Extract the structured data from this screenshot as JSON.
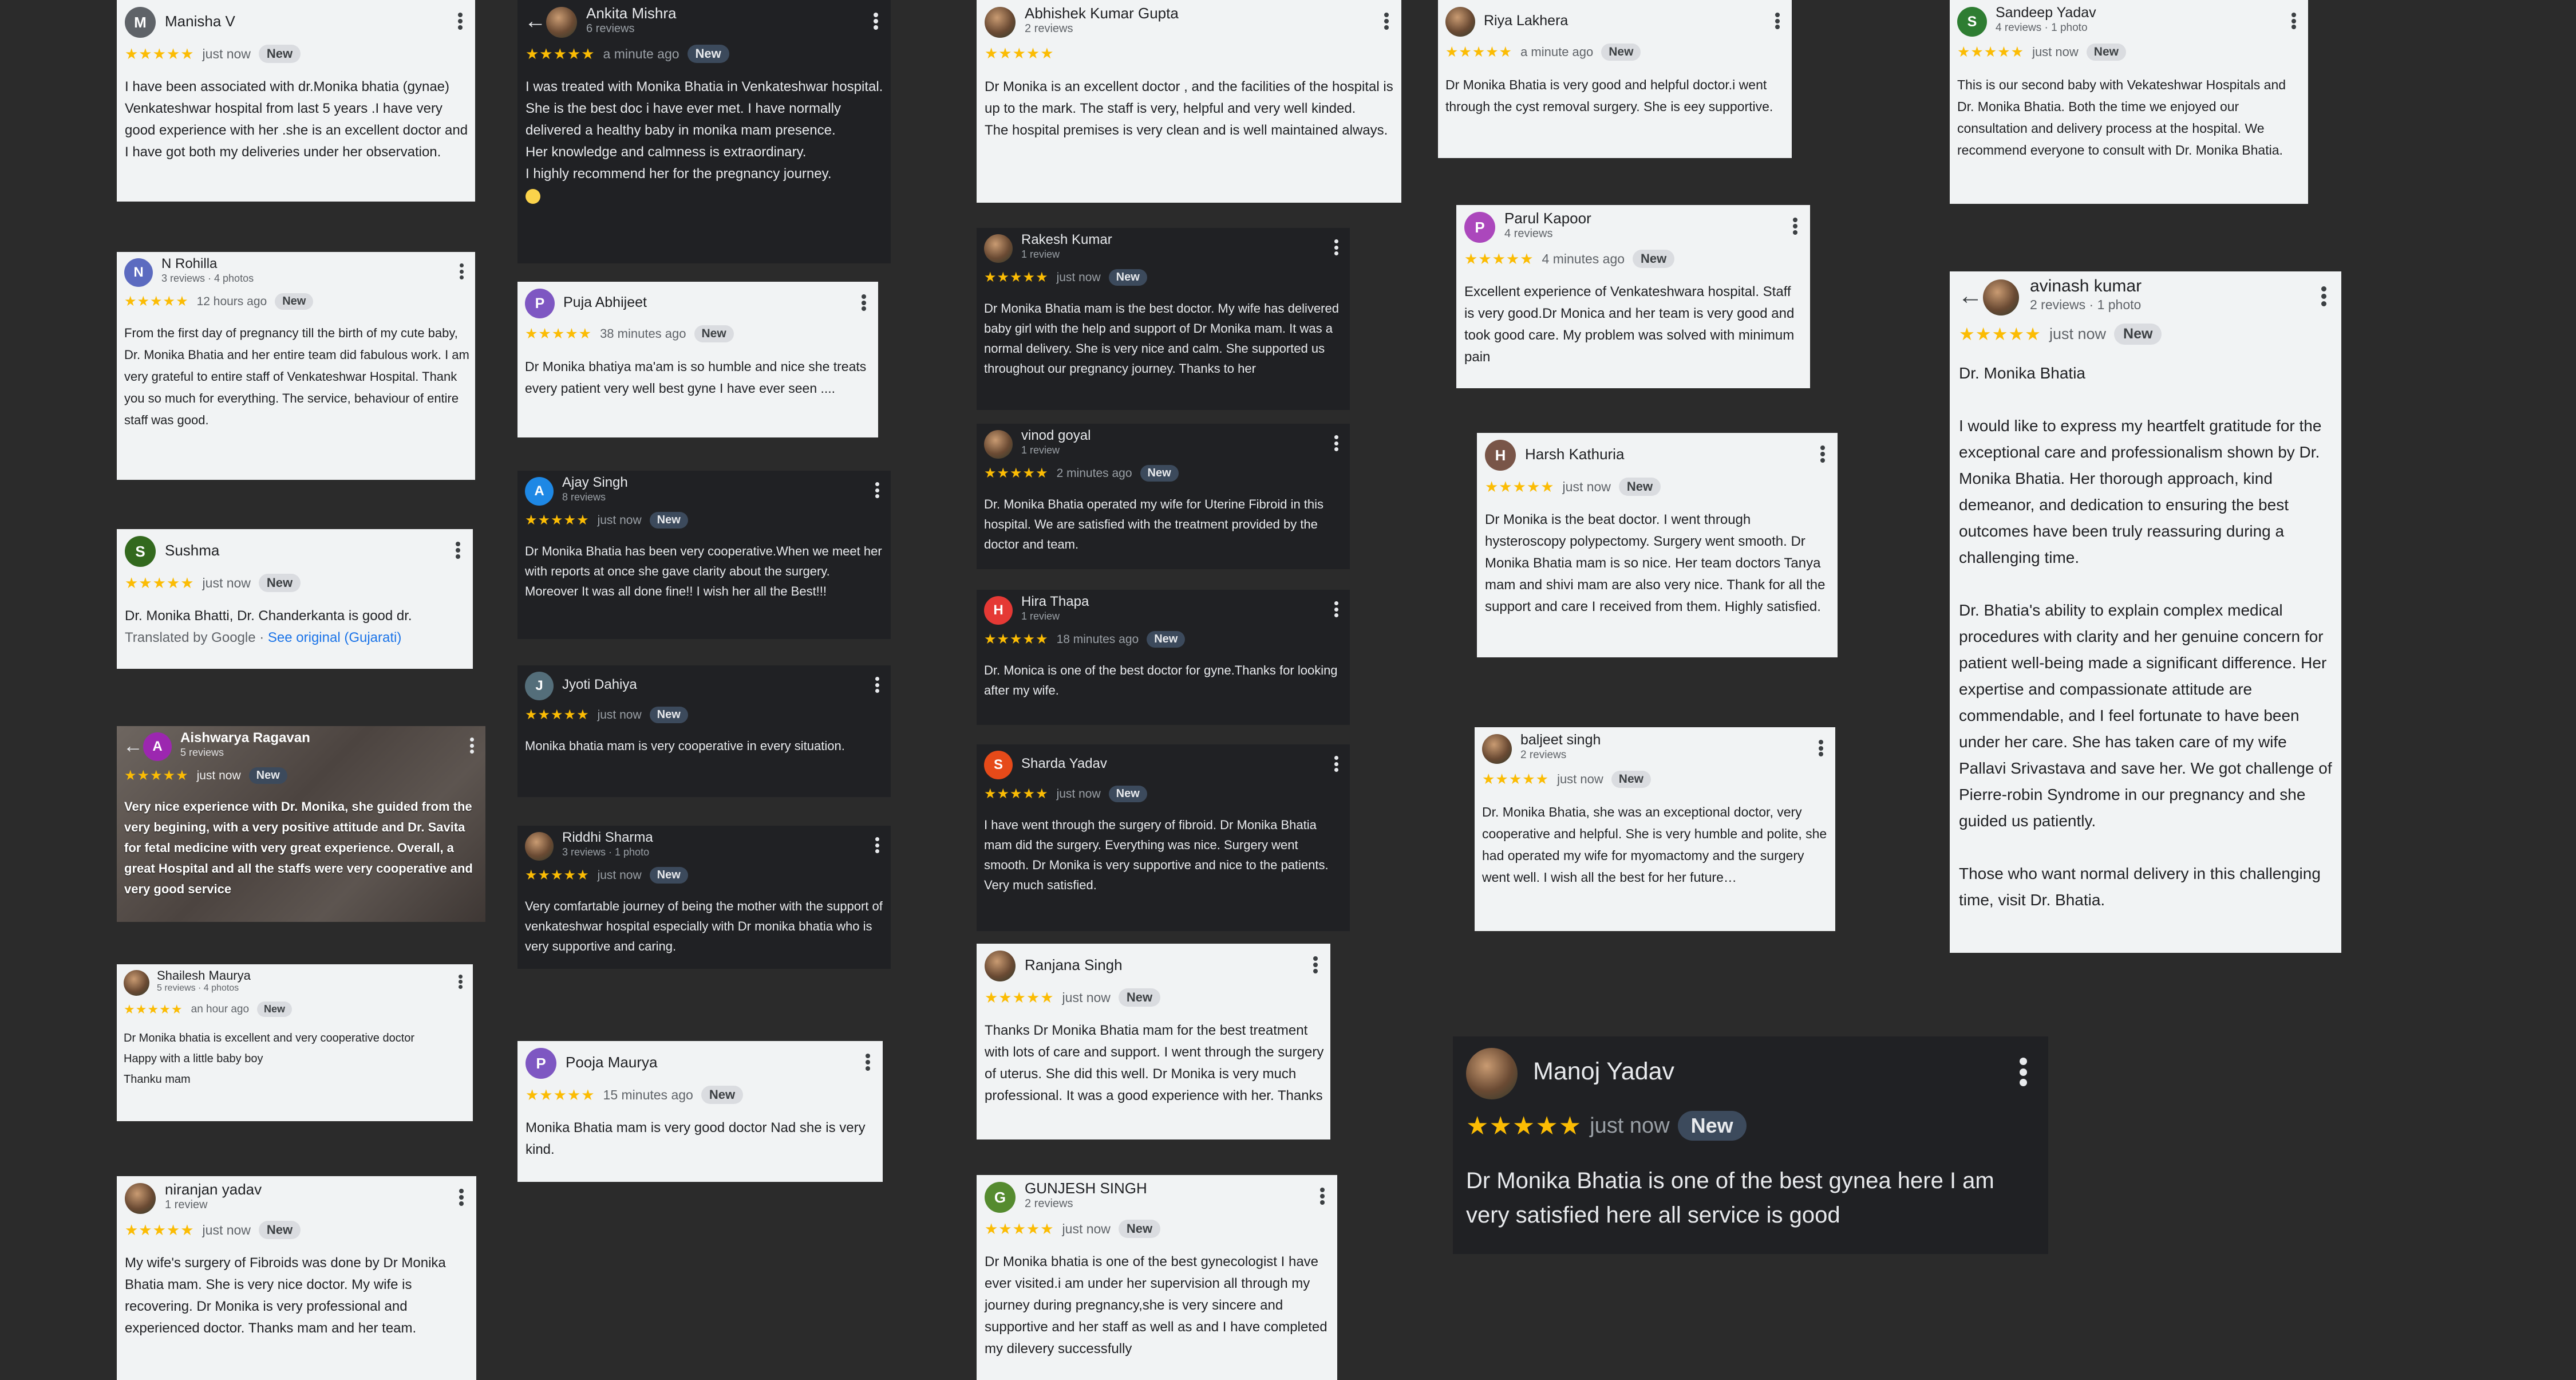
{
  "stars": "★★★★★",
  "new_badge": "New",
  "colors": {
    "star": "#fbbc04",
    "background": "#2b2b2b",
    "card": "#f1f3f4",
    "link": "#1a73e8"
  },
  "icons": {
    "menu": "kebab-menu-icon",
    "back": "back-arrow-icon"
  },
  "reviews": [
    {
      "name": "Manisha V",
      "initial": "M",
      "avatar_color": "#5f6368",
      "meta": "",
      "time": "just now",
      "text": "I have been associated with dr.Monika bhatia (gynae) Venkateshwar hospital from last 5 years .I have very good experience with her .she is an excellent doctor and I have got both my deliveries under her observation."
    },
    {
      "name": "N Rohilla",
      "initial": "N",
      "avatar_color": "#5c6bc0",
      "meta": "3 reviews · 4 photos",
      "time": "12 hours ago",
      "text": "From the first day of pregnancy till the birth of my cute baby, Dr. Monika Bhatia and her entire team did fabulous work. I am very grateful to entire staff of Venkateshwar Hospital. Thank you so much for everything. The service, behaviour of entire staff was good."
    },
    {
      "name": "Sushma",
      "initial": "S",
      "avatar_color": "#33691e",
      "meta": "",
      "time": "just now",
      "text": "Dr. Monika Bhatti, Dr. Chanderkanta is good dr.",
      "translated": "Translated by Google · ",
      "see_original": "See original (Gujarati)"
    },
    {
      "name": "Aishwarya Ragavan",
      "initial": "A",
      "avatar_color": "#9c27b0",
      "meta": "5 reviews",
      "time": "just now",
      "text": "Very nice experience with Dr. Monika, she guided from the very begining, with a very positive attitude and Dr. Savita for fetal medicine with very great experience. Overall, a great Hospital and all the staffs were very cooperative and very good service"
    },
    {
      "name": "Shailesh Maurya",
      "initial": "",
      "avatar_color": "#37474f",
      "meta": "5 reviews · 4 photos",
      "time": "an hour ago",
      "text": "Dr Monika bhatia is excellent and very cooperative doctor\nHappy with a little baby boy\nThanku mam"
    },
    {
      "name": "niranjan yadav",
      "initial": "",
      "avatar_color": "#3e4a2f",
      "meta": "1 review",
      "time": "just now",
      "text": "My wife's surgery of Fibroids was done by Dr Monika Bhatia mam. She is very nice doctor. My wife is recovering. Dr Monika is very professional and experienced doctor. Thanks mam and her team."
    },
    {
      "name": "Ankita Mishra",
      "initial": "",
      "avatar_color": "#5d4037",
      "meta": "6 reviews",
      "time": "a minute ago",
      "text": "I was treated with Monika Bhatia in Venkateshwar hospital. She is the best doc i have ever met. I have normally delivered a healthy baby in monika mam presence.\nHer knowledge and calmness is extraordinary.\nI highly recommend her for the pregnancy journey."
    },
    {
      "name": "Puja Abhijeet",
      "initial": "P",
      "avatar_color": "#7e57c2",
      "meta": "",
      "time": "38 minutes ago",
      "text": "Dr Monika bhatiya ma'am is so humble and nice she treats every patient very well best gyne I have ever seen ...."
    },
    {
      "name": "Ajay Singh",
      "initial": "A",
      "avatar_color": "#1e88e5",
      "meta": "8 reviews",
      "time": "just now",
      "text": "Dr Monika Bhatia has been very cooperative.When we meet her with reports at once she gave clarity about the surgery.\nMoreover It was all done fine!! I wish her all the Best!!!"
    },
    {
      "name": "Jyoti Dahiya",
      "initial": "J",
      "avatar_color": "#546e7a",
      "meta": "",
      "time": "just now",
      "text": "Monika bhatia mam is very cooperative in every situation."
    },
    {
      "name": "Riddhi Sharma",
      "initial": "",
      "avatar_color": "#6d6d5a",
      "meta": "3 reviews · 1 photo",
      "time": "just now",
      "text": "Very comfartable journey of being the mother with the support of venkateshwar hospital especially with Dr monika bhatia who is very supportive and caring."
    },
    {
      "name": "Pooja Maurya",
      "initial": "P",
      "avatar_color": "#7e57c2",
      "meta": "",
      "time": "15 minutes ago",
      "text": "Monika Bhatia mam is very good doctor Nad she is very kind."
    },
    {
      "name": "Abhishek Kumar Gupta",
      "initial": "",
      "avatar_color": "#5d4037",
      "meta": "2 reviews",
      "time": "",
      "text": "Dr Monika is an excellent doctor , and the facilities of the hospital is up to the mark. The staff is very, helpful and very well kinded.\nThe hospital premises is very clean and is well maintained always."
    },
    {
      "name": "Rakesh Kumar",
      "initial": "",
      "avatar_color": "#8d8d7a",
      "meta": "1 review",
      "time": "just now",
      "text": "Dr Monika Bhatia mam is the best doctor. My wife has delivered baby girl with the help and support of Dr Monika mam. It was a normal delivery. She is very nice and calm. She supported us throughout our pregnancy journey. Thanks to her"
    },
    {
      "name": "vinod goyal",
      "initial": "",
      "avatar_color": "#b26a00",
      "meta": "1 review",
      "time": "2 minutes ago",
      "text": "Dr. Monika Bhatia operated my wife for Uterine Fibroid in this hospital. We are satisfied with the treatment provided by the doctor and team."
    },
    {
      "name": "Hira Thapa",
      "initial": "H",
      "avatar_color": "#e53935",
      "meta": "1 review",
      "time": "18 minutes ago",
      "text": "Dr. Monica is one of the best doctor for gyne.Thanks for looking after my wife."
    },
    {
      "name": "Sharda Yadav",
      "initial": "S",
      "avatar_color": "#e64a19",
      "meta": "",
      "time": "just now",
      "text": "I have went through the surgery of fibroid. Dr Monika Bhatia mam did the surgery. Everything was nice. Surgery went smooth. Dr Monika is very supportive and nice to the patients.\nVery much satisfied."
    },
    {
      "name": "Ranjana Singh",
      "initial": "",
      "avatar_color": "#c62828",
      "meta": "",
      "time": "just now",
      "text": "Thanks Dr Monika Bhatia mam for the best treatment with lots of care and support. I went through the surgery of uterus. She did this well. Dr Monika is very much professional. It was a good experience with her. Thanks"
    },
    {
      "name": "GUNJESH SINGH",
      "initial": "G",
      "avatar_color": "#558b2f",
      "meta": "2 reviews",
      "time": "just now",
      "text": "Dr Monika bhatia is one of the best gynecologist I have ever visited.i am under her supervision all through my journey during pregnancy,she is very sincere and supportive and her staff as well as and I have completed my dilevery successfully"
    },
    {
      "name": "Riya Lakhera",
      "initial": "",
      "avatar_color": "#8d6e63",
      "meta": "",
      "time": "a minute ago",
      "text": "Dr Monika Bhatia is very good and helpful doctor.i went through the cyst removal surgery. She is eey supportive."
    },
    {
      "name": "Parul Kapoor",
      "initial": "P",
      "avatar_color": "#ab47bc",
      "meta": "4 reviews",
      "time": "4 minutes ago",
      "text": "Excellent experience of Venkateshwara hospital. Staff is very good.Dr Monica and her team is very good and took good care. My problem was solved with minimum pain"
    },
    {
      "name": "Harsh Kathuria",
      "initial": "H",
      "avatar_color": "#795548",
      "meta": "",
      "time": "just now",
      "text": "Dr Monika is the beat doctor. I went through hysteroscopy polypectomy. Surgery went smooth. Dr Monika Bhatia mam is so nice. Her team doctors Tanya mam and shivi mam are also very nice. Thank for all the support and care I received from them. Highly satisfied."
    },
    {
      "name": "baljeet singh",
      "initial": "",
      "avatar_color": "#c62828",
      "meta": "2 reviews",
      "time": "just now",
      "text": "Dr. Monika Bhatia, she was an exceptional doctor, very cooperative and helpful. She is very humble and polite, she had operated my wife for myomactomy and the surgery went well. I wish all the best for her future…"
    },
    {
      "name": "Manoj Yadav",
      "initial": "",
      "avatar_color": "#6a5a4a",
      "meta": "",
      "time": "just now",
      "text": "Dr Monika Bhatia is one of the best gynea here I am very satisfied here all service is good"
    },
    {
      "name": "Sandeep Yadav",
      "initial": "S",
      "avatar_color": "#2e7d32",
      "meta": "4 reviews · 1 photo",
      "time": "just now",
      "text": "This is our second baby with Vekateshwar Hospitals and Dr. Monika Bhatia. Both the time we enjoyed our consultation and delivery process at the hospital. We recommend everyone to consult with Dr. Monika Bhatia."
    },
    {
      "name": "avinash kumar",
      "initial": "",
      "avatar_color": "#e65100",
      "meta": "2 reviews · 1 photo",
      "time": "just now",
      "text": "Dr. Monika Bhatia\n\nI would like to express my heartfelt gratitude for the exceptional care and professionalism shown by Dr. Monika Bhatia. Her thorough approach, kind demeanor, and dedication to ensuring the best outcomes have been truly reassuring during a challenging time.\n\nDr. Bhatia's ability to explain complex medical procedures with clarity and her genuine concern for patient well-being made a significant difference. Her expertise and compassionate attitude are commendable, and I feel fortunate to have been under her care. She has taken care of my wife Pallavi Srivastava and save her. We got challenge of Pierre-robin Syndrome in our pregnancy and she guided us patiently.\n\nThose who want normal delivery in this challenging time, visit Dr. Bhatia."
    }
  ]
}
